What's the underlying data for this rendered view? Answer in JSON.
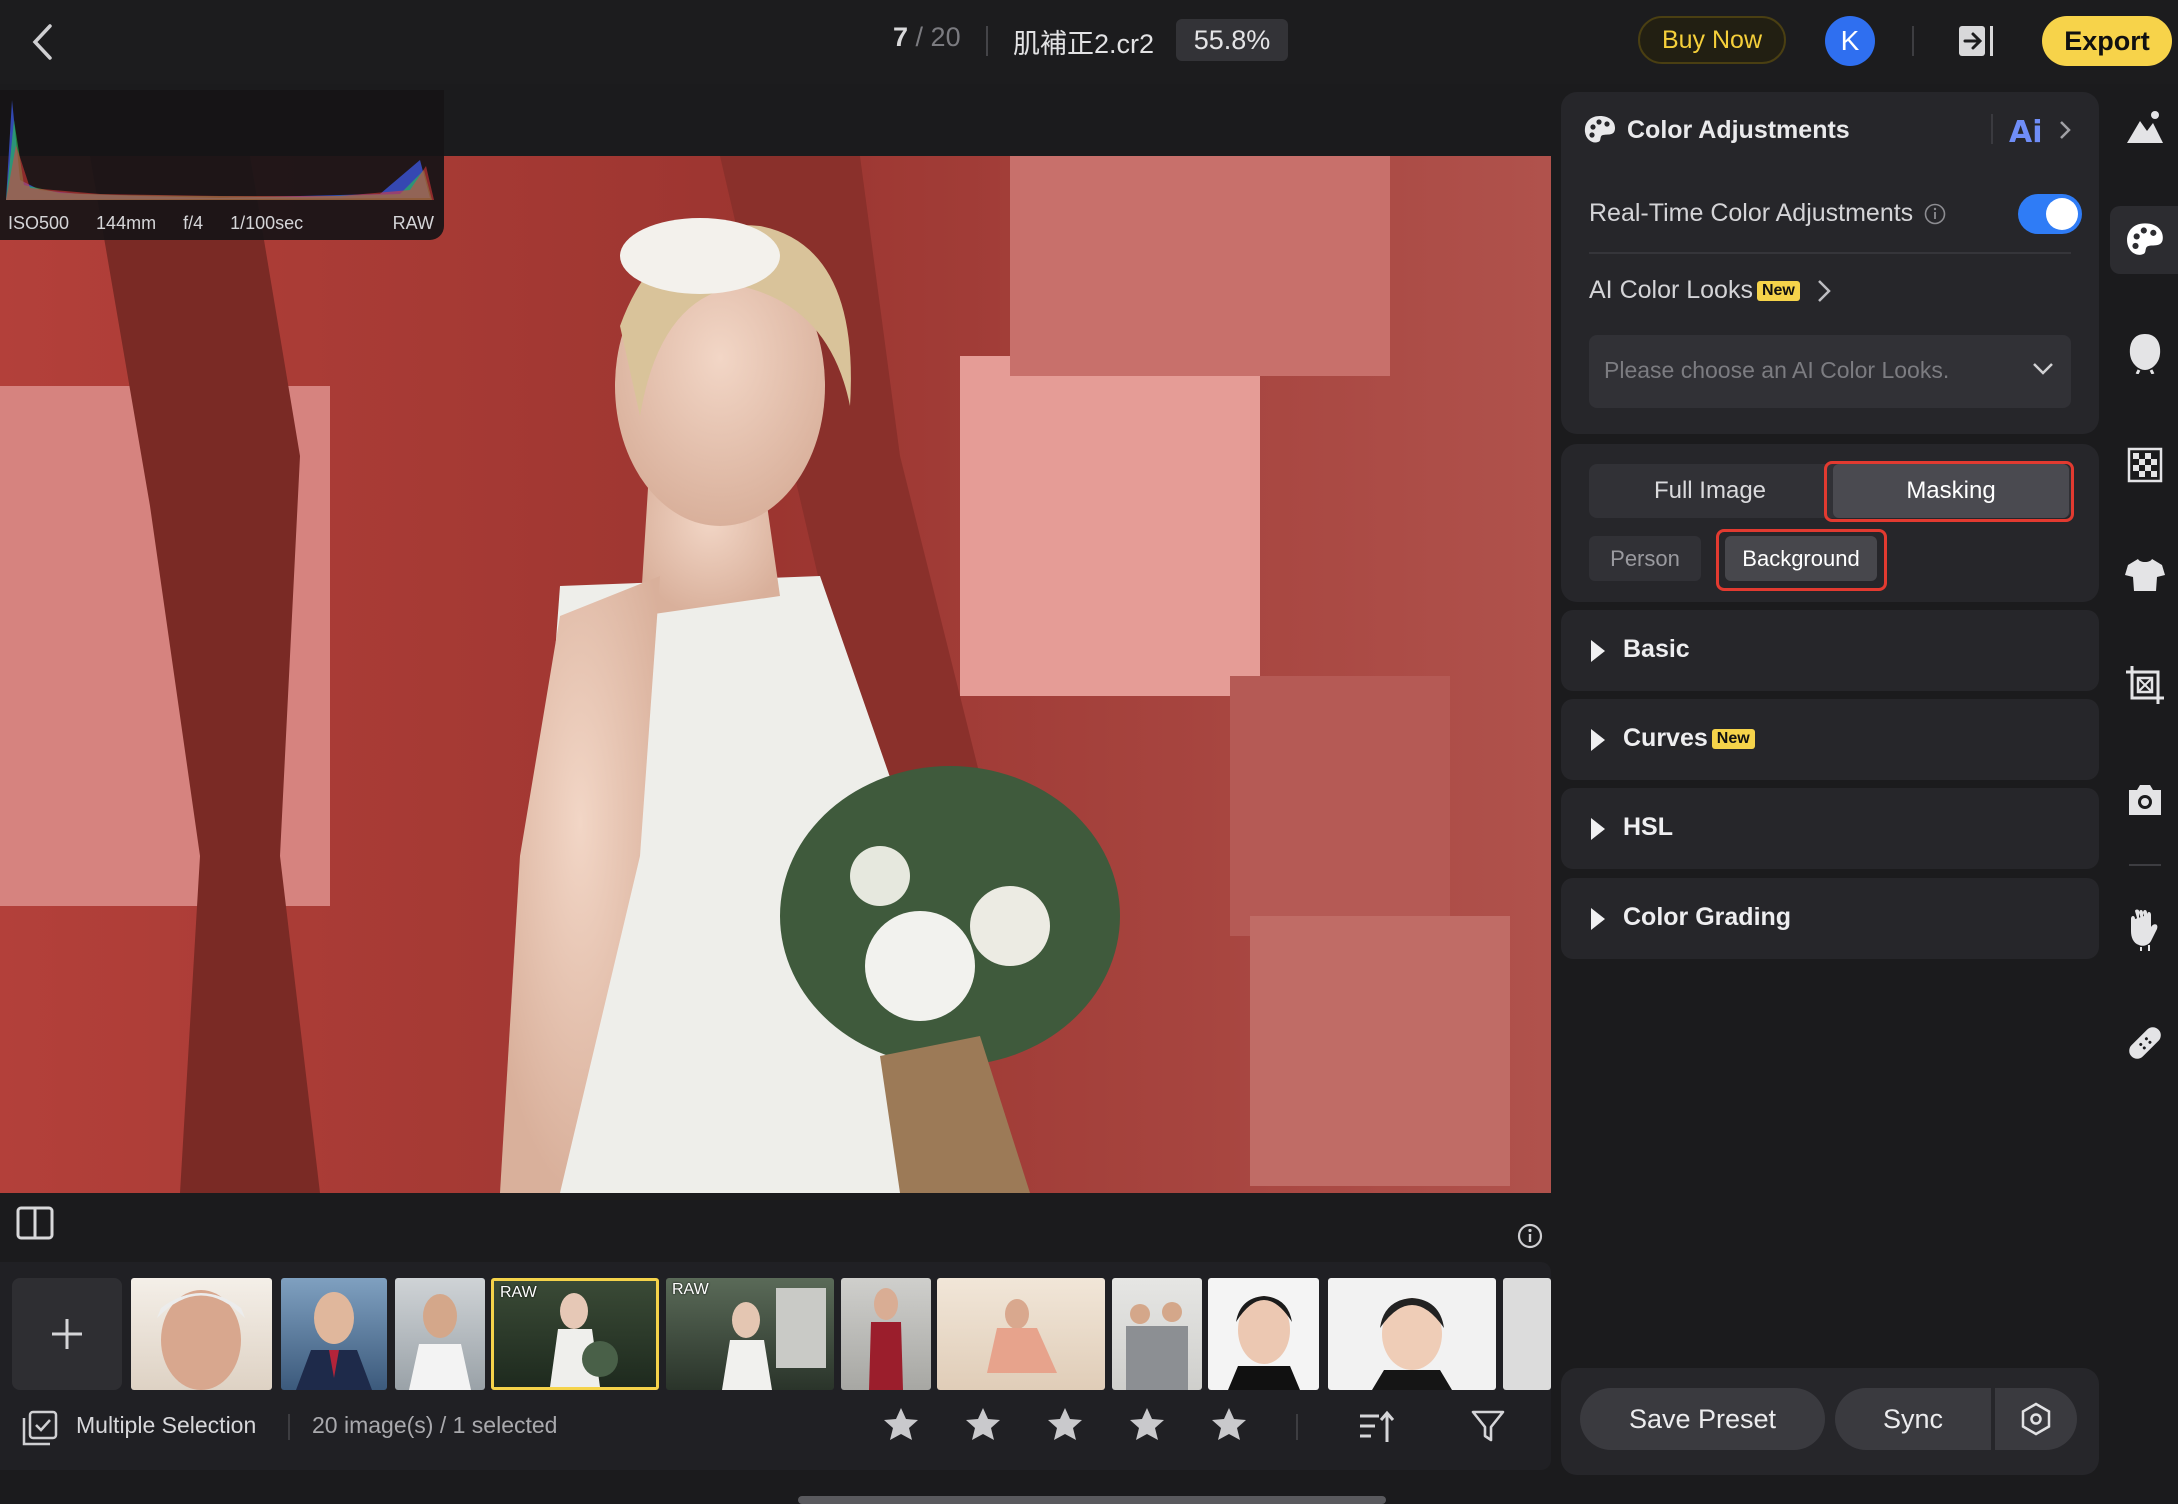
{
  "topbar": {
    "current_index": "7",
    "total_sep": " / ",
    "total": "20",
    "filename": "肌補正2.cr2",
    "zoom": "55.8%",
    "buy_now": "Buy Now",
    "avatar_letter": "K",
    "export": "Export"
  },
  "histogram": {
    "iso": "ISO500",
    "focal": "144mm",
    "aperture": "f/4",
    "shutter": "1/100sec",
    "format": "RAW"
  },
  "filmstrip": {
    "raw_tag": "RAW",
    "multiple_selection": "Multiple Selection",
    "count": "20 image(s) / 1 selected",
    "star_rating": 0
  },
  "panel": {
    "color_adjustments": {
      "title": "Color Adjustments",
      "realtime_label": "Real-Time Color Adjustments",
      "realtime_on": true,
      "ai_color_looks": "AI Color Looks",
      "new_badge": "New",
      "dropdown_placeholder": "Please choose an AI Color Looks."
    },
    "mode": {
      "full_image": "Full Image",
      "masking": "Masking",
      "selected": "Masking"
    },
    "mask_target": {
      "person": "Person",
      "background": "Background",
      "selected": "Background"
    },
    "sections": {
      "basic": "Basic",
      "curves": "Curves",
      "hsl": "HSL",
      "color_grading": "Color Grading"
    },
    "actions": {
      "save_preset": "Save Preset",
      "sync": "Sync"
    }
  },
  "colors": {
    "accent_yellow": "#f7d34a",
    "toggle_blue": "#2f7cf6",
    "highlight_red": "#e23a30",
    "mask_overlay": "#e05a5a"
  },
  "rail": {
    "icons": [
      "landscape-icon",
      "palette-icon",
      "face-icon",
      "checker-icon",
      "tshirt-icon",
      "crop-icon",
      "camera-icon",
      "hand-icon",
      "bandage-icon"
    ],
    "active": "palette-icon"
  }
}
